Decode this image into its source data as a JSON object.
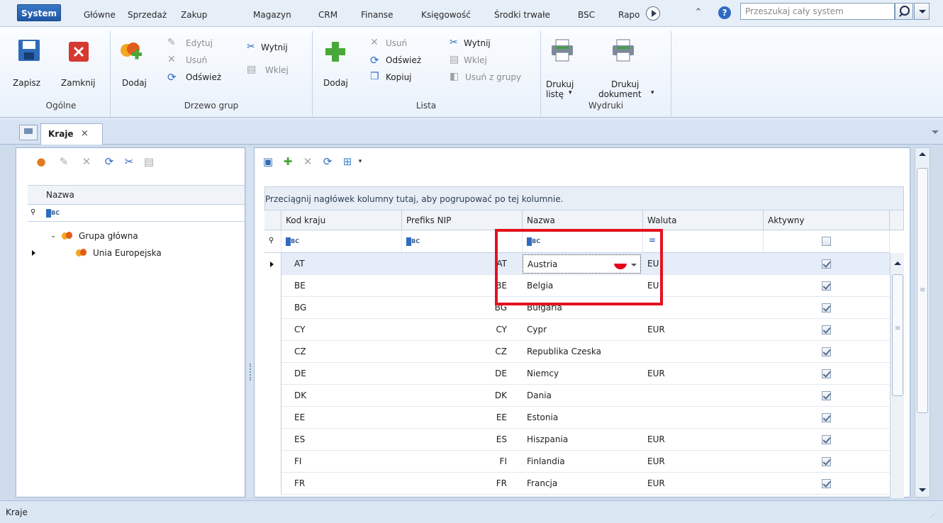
{
  "menu": {
    "tabs": [
      "System",
      "Główne",
      "Sprzedaż",
      "Zakup",
      "Magazyn",
      "CRM",
      "Finanse",
      "Księgowość",
      "Środki trwałe",
      "BSC",
      "Rapo"
    ],
    "search_placeholder": "Przeszukaj cały system"
  },
  "ribbon": {
    "general": {
      "save": "Zapisz",
      "close": "Zamknij",
      "label": "Ogólne"
    },
    "tree": {
      "add": "Dodaj",
      "edit": "Edytuj",
      "delete": "Usuń",
      "refresh": "Odśwież",
      "cut": "Wytnij",
      "paste": "Wklej",
      "label": "Drzewo grup"
    },
    "list": {
      "add": "Dodaj",
      "delete": "Usuń",
      "refresh": "Odśwież",
      "copy": "Kopiuj",
      "cut": "Wytnij",
      "paste": "Wklej",
      "remove_from_group": "Usuń z grupy",
      "label": "Lista"
    },
    "prints": {
      "print_list_1": "Drukuj",
      "print_list_2": "listę",
      "print_doc_1": "Drukuj",
      "print_doc_2": "dokument",
      "label": "Wydruki"
    }
  },
  "doc_tab": {
    "title": "Kraje",
    "close": "×"
  },
  "tree": {
    "header": "Nazwa",
    "items": [
      {
        "label": "Grupa główna",
        "caret": "⌄"
      },
      {
        "label": "Unia Europejska"
      }
    ]
  },
  "grid": {
    "group_hint": "Przeciągnij nagłówek kolumny tutaj, aby pogrupować po tej kolumnie.",
    "columns": [
      "Kod kraju",
      "Prefiks NIP",
      "Nazwa",
      "Waluta",
      "Aktywny"
    ],
    "filter_eq": "=",
    "rows": [
      {
        "code": "AT",
        "nip": "AT",
        "name": "Austria",
        "currency": "EU",
        "active": true
      },
      {
        "code": "BE",
        "nip": "BE",
        "name": "Belgia",
        "currency": "EU",
        "active": true
      },
      {
        "code": "BG",
        "nip": "BG",
        "name": "Bułgaria",
        "currency": "",
        "active": true
      },
      {
        "code": "CY",
        "nip": "CY",
        "name": "Cypr",
        "currency": "EUR",
        "active": true
      },
      {
        "code": "CZ",
        "nip": "CZ",
        "name": "Republika Czeska",
        "currency": "",
        "active": true
      },
      {
        "code": "DE",
        "nip": "DE",
        "name": "Niemcy",
        "currency": "EUR",
        "active": true
      },
      {
        "code": "DK",
        "nip": "DK",
        "name": "Dania",
        "currency": "",
        "active": true
      },
      {
        "code": "EE",
        "nip": "EE",
        "name": "Estonia",
        "currency": "",
        "active": true
      },
      {
        "code": "ES",
        "nip": "ES",
        "name": "Hiszpania",
        "currency": "EUR",
        "active": true
      },
      {
        "code": "FI",
        "nip": "FI",
        "name": "Finlandia",
        "currency": "EUR",
        "active": true
      },
      {
        "code": "FR",
        "nip": "FR",
        "name": "Francja",
        "currency": "EUR",
        "active": true
      }
    ]
  },
  "status": {
    "text": "Kraje"
  },
  "colors": {
    "accent": "#1f57a3",
    "highlight": "#e3121f",
    "selected_row": "#e4edf8"
  }
}
